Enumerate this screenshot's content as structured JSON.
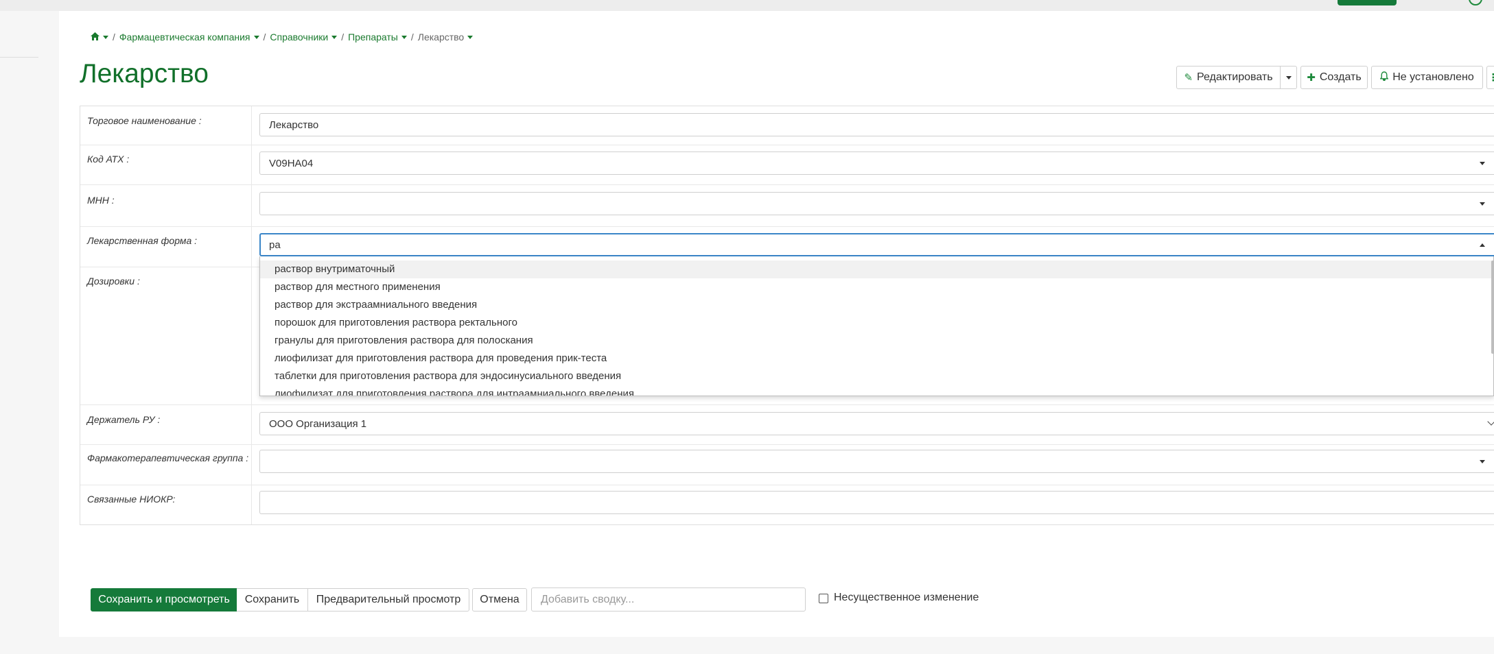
{
  "breadcrumb": {
    "items": [
      "Фармацевтическая компания",
      "Справочники",
      "Препараты"
    ],
    "current": "Лекарство",
    "separator": "/"
  },
  "page": {
    "title": "Лекарство"
  },
  "toolbar": {
    "edit_label": "Редактировать",
    "create_label": "Создать",
    "notify_label": "Не установлено"
  },
  "form": {
    "trade_name": {
      "label": "Торговое наименование :",
      "value": "Лекарство"
    },
    "atc_code": {
      "label": "Код АТХ :",
      "value": "V09HA04"
    },
    "inn": {
      "label": "МНН :",
      "value": ""
    },
    "dosage_form": {
      "label": "Лекарственная форма :",
      "value": "ра"
    },
    "dosages": {
      "label": "Дозировки :"
    },
    "holder": {
      "label": "Держатель РУ :",
      "value": "ООО Организация 1"
    },
    "pharm_group": {
      "label": "Фармакотерапевтическая группа :",
      "value": ""
    },
    "related_rd": {
      "label": "Связанные НИОКР:",
      "value": ""
    }
  },
  "dropdown": {
    "options": [
      "раствор внутриматочный",
      "раствор для местного применения",
      "раствор для экстраамниального введения",
      "порошок для приготовления раствора ректального",
      "гранулы для приготовления раствора для полоскания",
      "лиофилизат для приготовления раствора для проведения прик-теста",
      "таблетки для приготовления раствора для эндосинусиального введения",
      "лиофилизат для приготовления раствора для интраамниального введения"
    ]
  },
  "actions": {
    "save_view": "Сохранить и просмотреть",
    "save": "Сохранить",
    "preview": "Предварительный просмотр",
    "cancel": "Отмена",
    "summary_placeholder": "Добавить сводку...",
    "minor_change": "Несущественное изменение"
  },
  "colors": {
    "accent": "#157a3a",
    "link": "#1a7a2e",
    "focus": "#3a86c8"
  }
}
